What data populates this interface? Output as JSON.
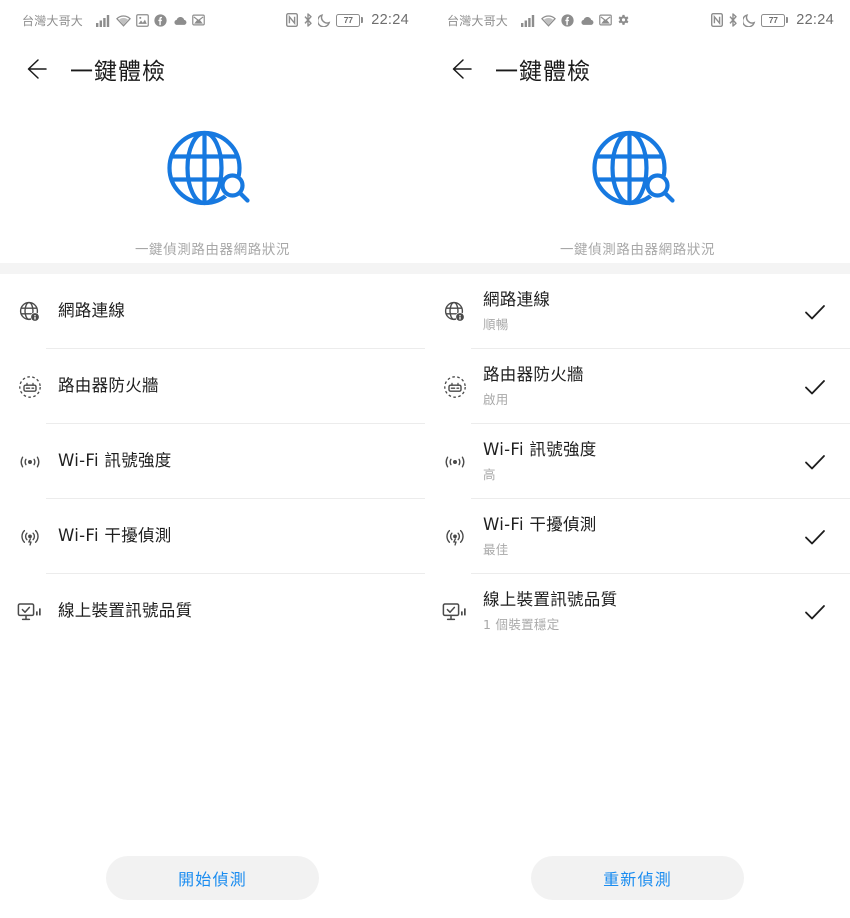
{
  "statusbar": {
    "carrier": "台灣大哥大",
    "battery_level": "77",
    "time": "22:24",
    "left_icons_left_screen": [
      "signal-bars-icon",
      "wifi-icon",
      "image-icon",
      "facebook-icon",
      "cloud-icon",
      "gmail-icon"
    ],
    "left_icons_right_screen": [
      "signal-bars-icon",
      "wifi-icon",
      "facebook-icon",
      "cloud-icon",
      "gmail-icon",
      "gear-icon"
    ],
    "right_icons": [
      "nfc-icon",
      "bluetooth-icon",
      "do-not-disturb-moon-icon",
      "battery-icon"
    ]
  },
  "appbar": {
    "back_icon": "arrow-left-icon",
    "title": "一鍵體檢"
  },
  "hero": {
    "icon": "globe-search-icon",
    "icon_color": "#1779e0",
    "subtitle": "一鍵偵測路由器網路狀況"
  },
  "accent_color": "#1a8cf0",
  "left_screen": {
    "button_label": "開始偵測",
    "items": [
      {
        "icon": "globe-info-icon",
        "title": "網路連線",
        "status": ""
      },
      {
        "icon": "router-shield-icon",
        "title": "路由器防火牆",
        "status": ""
      },
      {
        "icon": "wifi-signal-icon",
        "title": "Wi-Fi 訊號強度",
        "status": ""
      },
      {
        "icon": "wifi-interference-icon",
        "title": "Wi-Fi 干擾偵測",
        "status": ""
      },
      {
        "icon": "monitor-check-icon",
        "title": "線上裝置訊號品質",
        "status": ""
      }
    ]
  },
  "right_screen": {
    "button_label": "重新偵測",
    "items": [
      {
        "icon": "globe-info-icon",
        "title": "網路連線",
        "status": "順暢",
        "checked": true
      },
      {
        "icon": "router-shield-icon",
        "title": "路由器防火牆",
        "status": "啟用",
        "checked": true
      },
      {
        "icon": "wifi-signal-icon",
        "title": "Wi-Fi 訊號強度",
        "status": "高",
        "checked": true
      },
      {
        "icon": "wifi-interference-icon",
        "title": "Wi-Fi 干擾偵測",
        "status": "最佳",
        "checked": true
      },
      {
        "icon": "monitor-check-icon",
        "title": "線上裝置訊號品質",
        "status": "1 個裝置穩定",
        "checked": true
      }
    ]
  }
}
